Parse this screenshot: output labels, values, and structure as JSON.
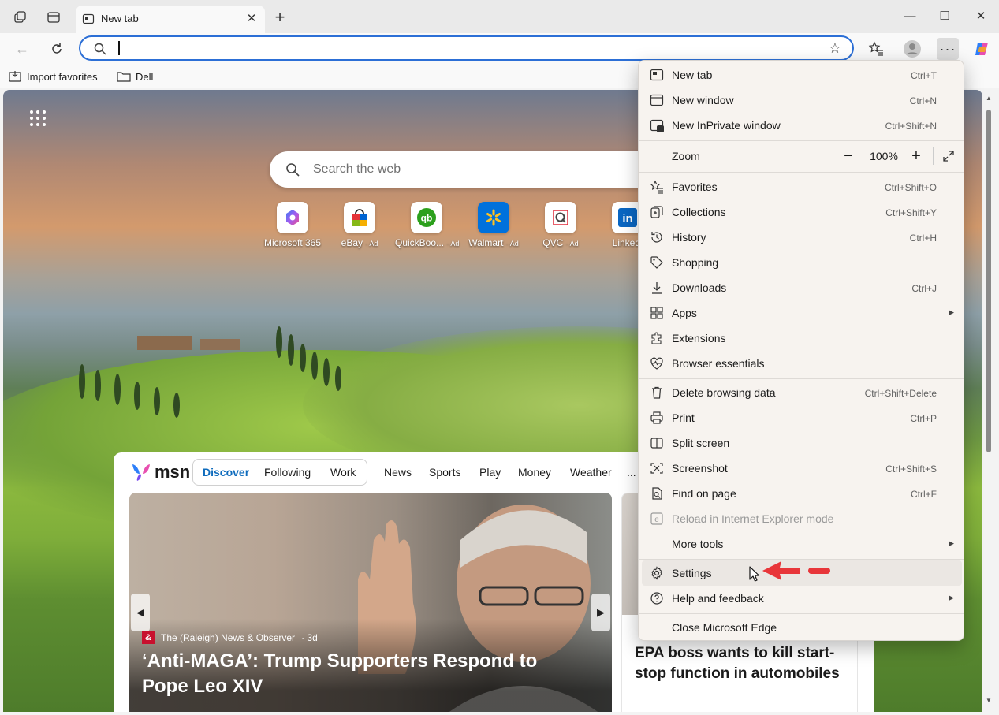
{
  "browser": {
    "tab": {
      "title": "New tab"
    },
    "address_bar": {
      "value": "",
      "placeholder": ""
    },
    "favorites_bar": [
      {
        "label": "Import favorites",
        "icon": "import-icon"
      },
      {
        "label": "Dell",
        "icon": "folder-icon"
      }
    ]
  },
  "newtab": {
    "search_placeholder": "Search the web",
    "quick_links": [
      {
        "label": "Microsoft 365",
        "ad": ""
      },
      {
        "label": "eBay",
        "ad": "· Ad"
      },
      {
        "label": "QuickBoo...",
        "ad": "· Ad"
      },
      {
        "label": "Walmart",
        "ad": "· Ad"
      },
      {
        "label": "QVC",
        "ad": "· Ad"
      },
      {
        "label": "LinkedI",
        "ad": ""
      }
    ],
    "feed": {
      "logo": "msn",
      "tabs": [
        "Discover",
        "Following",
        "Work",
        "News",
        "Sports",
        "Play",
        "Money",
        "Weather",
        "..."
      ],
      "main_card": {
        "source": "The (Raleigh) News & Observer",
        "age": "· 3d",
        "headline": "‘Anti-MAGA’: Trump Supporters Respond to Pope Leo XIV"
      },
      "side_card": {
        "headline": "EPA boss wants to kill start-stop function in automobiles"
      }
    }
  },
  "menu": {
    "items": [
      {
        "label": "New tab",
        "shortcut": "Ctrl+T",
        "icon": "new-tab-icon"
      },
      {
        "label": "New window",
        "shortcut": "Ctrl+N",
        "icon": "new-window-icon"
      },
      {
        "label": "New InPrivate window",
        "shortcut": "Ctrl+Shift+N",
        "icon": "inprivate-icon"
      },
      {
        "label": "Zoom",
        "value": "100%"
      },
      {
        "label": "Favorites",
        "shortcut": "Ctrl+Shift+O",
        "icon": "favorites-icon"
      },
      {
        "label": "Collections",
        "shortcut": "Ctrl+Shift+Y",
        "icon": "collections-icon"
      },
      {
        "label": "History",
        "shortcut": "Ctrl+H",
        "icon": "history-icon"
      },
      {
        "label": "Shopping",
        "shortcut": "",
        "icon": "shopping-tag-icon"
      },
      {
        "label": "Downloads",
        "shortcut": "Ctrl+J",
        "icon": "download-icon"
      },
      {
        "label": "Apps",
        "shortcut": "",
        "icon": "apps-icon"
      },
      {
        "label": "Extensions",
        "shortcut": "",
        "icon": "extensions-icon"
      },
      {
        "label": "Browser essentials",
        "shortcut": "",
        "icon": "heart-pulse-icon"
      },
      {
        "label": "Delete browsing data",
        "shortcut": "Ctrl+Shift+Delete",
        "icon": "trash-icon"
      },
      {
        "label": "Print",
        "shortcut": "Ctrl+P",
        "icon": "print-icon"
      },
      {
        "label": "Split screen",
        "shortcut": "",
        "icon": "split-screen-icon"
      },
      {
        "label": "Screenshot",
        "shortcut": "Ctrl+Shift+S",
        "icon": "screenshot-icon"
      },
      {
        "label": "Find on page",
        "shortcut": "Ctrl+F",
        "icon": "find-icon"
      },
      {
        "label": "Reload in Internet Explorer mode",
        "shortcut": "",
        "icon": "ie-mode-icon"
      },
      {
        "label": "More tools",
        "shortcut": "",
        "icon": ""
      },
      {
        "label": "Settings",
        "shortcut": "",
        "icon": "gear-icon"
      },
      {
        "label": "Help and feedback",
        "shortcut": "",
        "icon": "help-icon"
      },
      {
        "label": "Close Microsoft Edge",
        "shortcut": ""
      }
    ]
  },
  "colors": {
    "accent": "#2c6fd6",
    "annotation_arrow": "#e8363a",
    "msn_active": "#0f6cbd"
  }
}
